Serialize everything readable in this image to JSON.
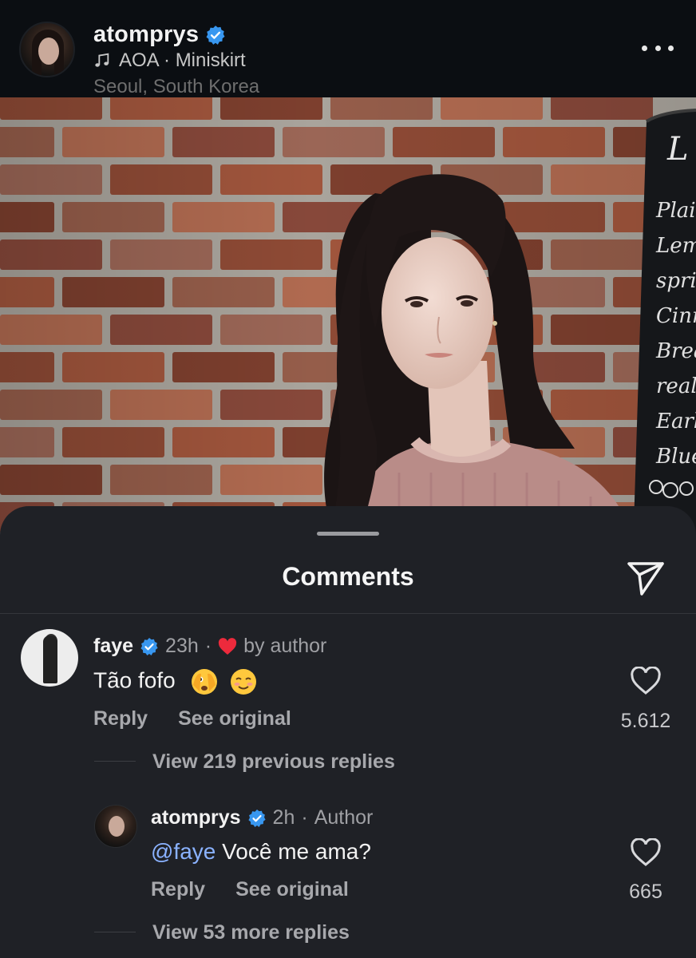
{
  "header": {
    "username": "atomprys",
    "song": "AOA · Miniskirt",
    "location": "Seoul, South Korea"
  },
  "photo": {
    "chalkboard_lines": [
      "Plain",
      "Lemo",
      "sprin",
      "Cinn",
      "Bread",
      "real",
      "Earlg",
      "Blueber"
    ],
    "chalkboard_heading": "L"
  },
  "sheet": {
    "title": "Comments"
  },
  "comments": [
    {
      "username": "faye",
      "time": "23h",
      "dot": "·",
      "author_like_label": "by author",
      "text": "Tão fofo",
      "reply_label": "Reply",
      "see_original_label": "See original",
      "likes": "5.612",
      "view_replies": "View 219 previous replies"
    }
  ],
  "replies": [
    {
      "username": "atomprys",
      "time": "2h",
      "dot": "·",
      "tag": "Author",
      "mention": "@faye",
      "text": " Você me ama?",
      "reply_label": "Reply",
      "see_original_label": "See original",
      "likes": "665",
      "view_more": "View 53 more replies"
    }
  ],
  "colors": {
    "verified": "#3897f0",
    "author_heart": "#ed2a3c",
    "mention": "#8ab2ff",
    "sheet_bg": "#1f2126"
  }
}
